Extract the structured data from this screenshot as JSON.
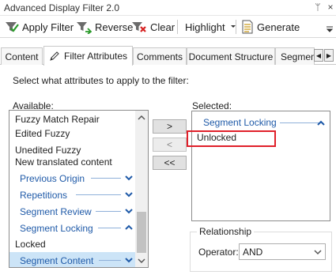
{
  "window": {
    "title": "Advanced Display Filter 2.0",
    "pin_glyph": "ᛘ",
    "close_glyph": "×"
  },
  "toolbar": {
    "apply_label": "Apply Filter",
    "reverse_label": "Reverse",
    "clear_label": "Clear",
    "highlight_label": "Highlight",
    "generate_label": "Generate"
  },
  "tabs": [
    "Content",
    "Filter Attributes",
    "Comments",
    "Document Structure",
    "Segment"
  ],
  "tab_scroll": {
    "left": "◀",
    "right": "▶"
  },
  "panel": {
    "instruction": "Select what attributes to apply to the filter:",
    "available_label": "Available:",
    "selected_label": "Selected:"
  },
  "available_items": [
    {
      "label": "Fuzzy Match Repair",
      "type": "item"
    },
    {
      "label": "Edited Fuzzy",
      "type": "item"
    },
    {
      "label": "Unedited Fuzzy",
      "type": "item"
    },
    {
      "label": "New translated content",
      "type": "item"
    },
    {
      "label": "Previous Origin",
      "type": "group",
      "expanded": false
    },
    {
      "label": "Repetitions",
      "type": "group",
      "expanded": false
    },
    {
      "label": "Segment Review",
      "type": "group",
      "expanded": false
    },
    {
      "label": "Segment Locking",
      "type": "group",
      "expanded": true
    },
    {
      "label": "Locked",
      "type": "item"
    },
    {
      "label": "Segment Content",
      "type": "group",
      "expanded": false,
      "selected": true
    }
  ],
  "move_buttons": {
    "add": ">",
    "remove": "<",
    "remove_all": "<<"
  },
  "selected": {
    "group": "Segment Locking",
    "item": "Unlocked"
  },
  "relationship": {
    "legend": "Relationship",
    "operator_label": "Operator:",
    "operator_value": "AND"
  },
  "colors": {
    "group_text": "#1f5aa8",
    "selection": "#cce4f7",
    "highlight_border": "#e0202a"
  }
}
